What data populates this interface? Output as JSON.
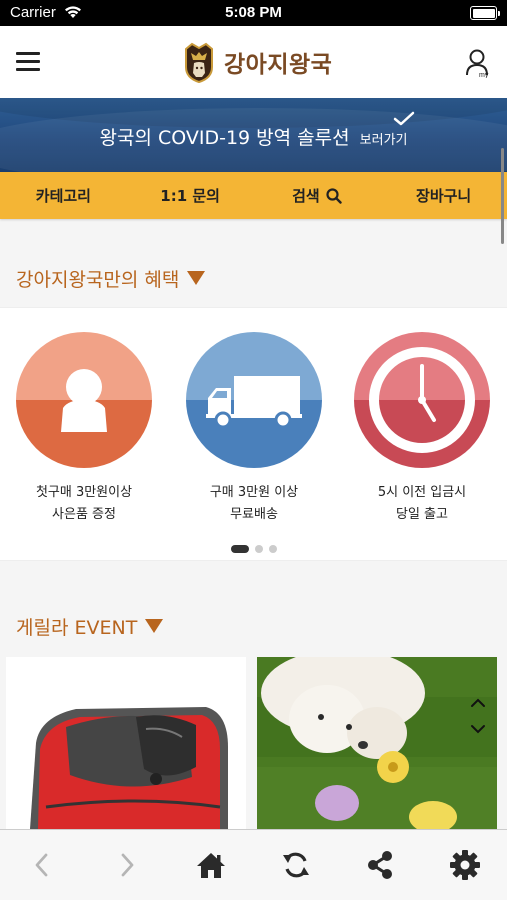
{
  "status_bar": {
    "carrier": "Carrier",
    "time": "5:08 PM"
  },
  "header": {
    "brand": "강아지왕국",
    "my_badge": "my",
    "icons": [
      "menu-icon",
      "dog-crest-logo",
      "my-account-icon"
    ]
  },
  "banner": {
    "text": "왕국의 COVID-19 방역 솔루션",
    "link": "보러가기"
  },
  "nav": {
    "items": [
      "카테고리",
      "1:1 문의",
      "검색",
      "장바구니"
    ]
  },
  "benefits": {
    "title": "강아지왕국만의 혜택",
    "items": [
      {
        "line1": "첫구매 3만원이상",
        "line2": "사은품 증정",
        "icon": "person-icon",
        "color_top": "#f1a287",
        "color_bottom": "#dd6a42"
      },
      {
        "line1": "구매 3만원 이상",
        "line2": "무료배송",
        "icon": "truck-icon",
        "color_top": "#7ea9d3",
        "color_bottom": "#4a80bb"
      },
      {
        "line1": "5시 이전 입금시",
        "line2": "당일 출고",
        "icon": "clock-icon",
        "color_top": "#e47c82",
        "color_bottom": "#c84a55"
      }
    ],
    "page_count": 3,
    "active_page": 1
  },
  "event": {
    "title": "게릴라 EVENT",
    "cards": [
      "pet-carrier-bag-photo",
      "white-puppy-toys-photo"
    ]
  },
  "toolbar": {
    "icons": [
      "back-icon",
      "forward-icon",
      "home-icon",
      "refresh-icon",
      "share-icon",
      "settings-icon"
    ]
  },
  "colors": {
    "accent": "#f4b535",
    "brand_brown": "#7a4a24",
    "section_title": "#b8651e",
    "banner_blue": "#21497e"
  }
}
